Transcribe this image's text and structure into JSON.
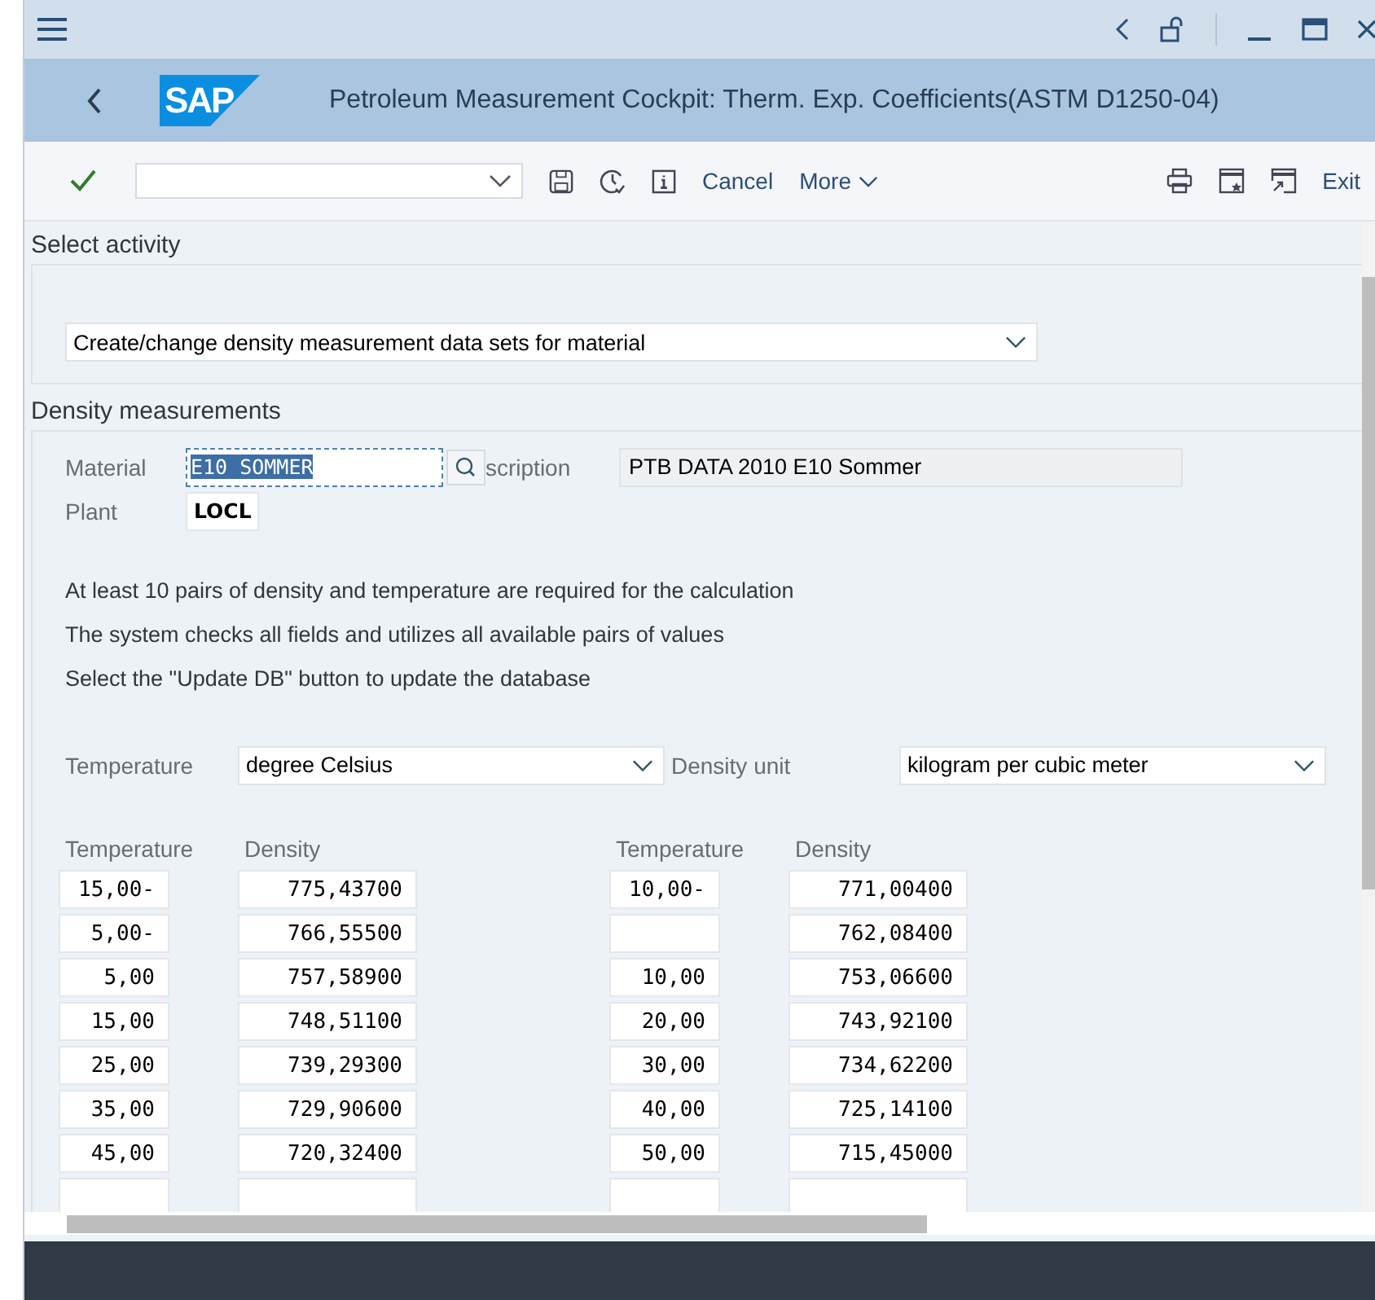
{
  "header": {
    "logo": "SAP",
    "title": "Petroleum Measurement Cockpit: Therm. Exp. Coefficients(ASTM D1250-04)"
  },
  "toolbar": {
    "buttons": [
      "Cancel",
      "More"
    ],
    "exit": "Exit"
  },
  "select_activity": {
    "title": "Select activity",
    "value": "Create/change density measurement data sets for material"
  },
  "density_measurements": {
    "title": "Density measurements",
    "material": {
      "label": "Material",
      "value": "E10 SOMMER",
      "selected": true
    },
    "description": {
      "label": "scription",
      "value": "PTB DATA 2010 E10 Sommer"
    },
    "plant": {
      "label": "Plant",
      "value": "LOCL"
    },
    "notes": [
      "At least 10 pairs of density and temperature are required for the calculation",
      "The system checks all fields and utilizes all available pairs of values",
      "Select the \"Update DB\" button to update the database"
    ],
    "temperature_unit": {
      "label": "Temperature",
      "value": "degree Celsius"
    },
    "density_unit": {
      "label": "Density unit",
      "value": "kilogram per cubic meter"
    },
    "columns": [
      "Temperature",
      "Density",
      "Temperature",
      "Density"
    ],
    "rows": [
      {
        "t1": "15,00-",
        "d1": "775,43700",
        "t2": "10,00-",
        "d2": "771,00400"
      },
      {
        "t1": "5,00-",
        "d1": "766,55500",
        "d2": "762,08400"
      },
      {
        "t1": "5,00",
        "d1": "757,58900",
        "t2": "10,00",
        "d2": "753,06600"
      },
      {
        "t1": "15,00",
        "d1": "748,51100",
        "t2": "20,00",
        "d2": "743,92100"
      },
      {
        "t1": "25,00",
        "d1": "739,29300",
        "t2": "30,00",
        "d2": "734,62200"
      },
      {
        "t1": "35,00",
        "d1": "729,90600",
        "t2": "40,00",
        "d2": "725,14100"
      },
      {
        "t1": "45,00",
        "d1": "720,32400",
        "t2": "50,00",
        "d2": "715,45000"
      }
    ]
  }
}
